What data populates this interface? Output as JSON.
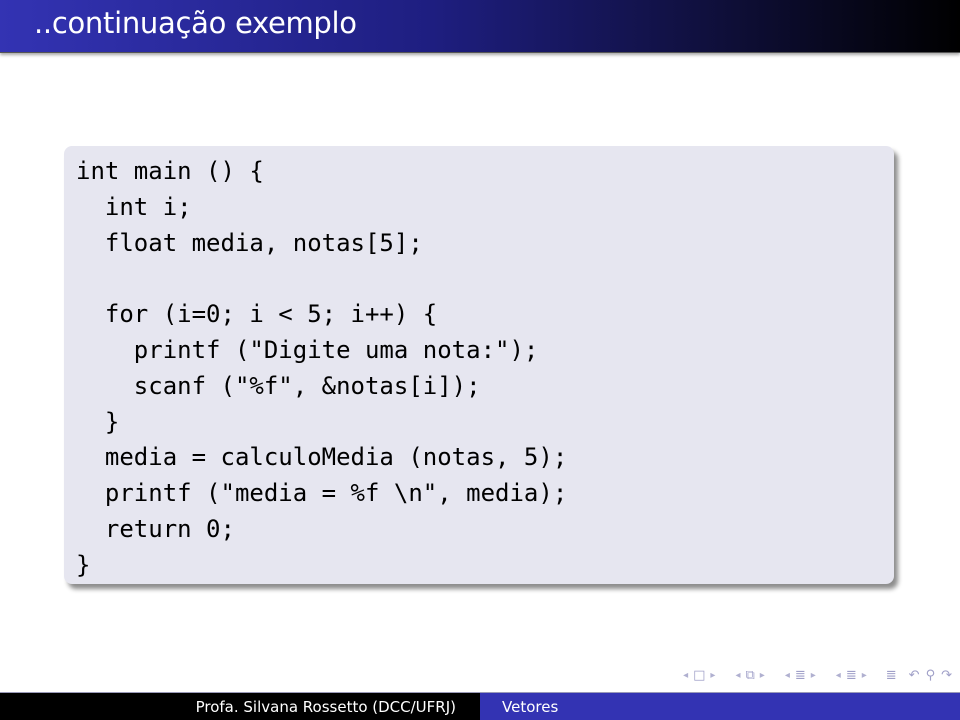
{
  "frame": {
    "title": "..continuação exemplo"
  },
  "code_block": {
    "lines": [
      "int main () {",
      "  int i;",
      "  float media, notas[5];",
      "",
      "  for (i=0; i < 5; i++) {",
      "    printf (\"Digite uma nota:\");",
      "    scanf (\"%f\", &notas[i]);",
      "  }",
      "  media = calculoMedia (notas, 5);",
      "  printf (\"media = %f \\n\", media);",
      "  return 0;",
      "}"
    ]
  },
  "navigation": {
    "icons": {
      "prev": "◂",
      "next": "▸",
      "frame": "□",
      "subsection": "⧉",
      "section": "≣",
      "doc": "≣",
      "undo": "↶",
      "search": "⚲",
      "redo": "↷"
    }
  },
  "footer": {
    "author": "Profa. Silvana Rossetto (DCC/UFRJ)",
    "short_title": "Vetores"
  },
  "colors": {
    "title_bg_start": "#3333b3",
    "title_bg_end": "#000000",
    "block_bg": "#e6e6f0",
    "footer_left_bg": "#000000",
    "footer_right_bg": "#3333b3",
    "nav_icon": "#a0a0c8"
  }
}
